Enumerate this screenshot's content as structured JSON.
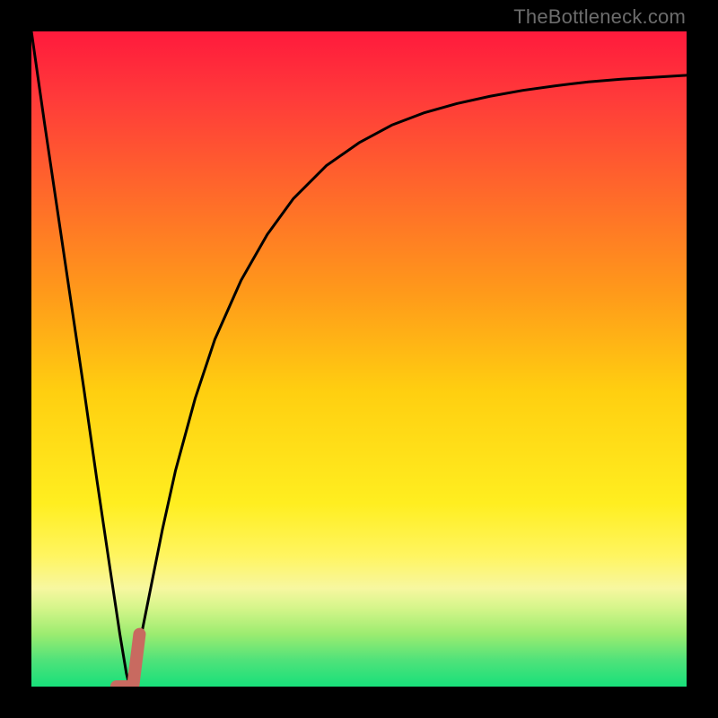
{
  "watermark": "TheBottleneck.com",
  "chart_data": {
    "type": "line",
    "title": "",
    "xlabel": "",
    "ylabel": "",
    "xlim": [
      0,
      100
    ],
    "ylim": [
      0,
      100
    ],
    "background": {
      "gradient_stops": [
        {
          "pos": 0.0,
          "color": "#ff1a3c"
        },
        {
          "pos": 0.1,
          "color": "#ff3a3a"
        },
        {
          "pos": 0.25,
          "color": "#ff6a2a"
        },
        {
          "pos": 0.4,
          "color": "#ff9a1a"
        },
        {
          "pos": 0.55,
          "color": "#ffcf10"
        },
        {
          "pos": 0.72,
          "color": "#ffee20"
        },
        {
          "pos": 0.8,
          "color": "#fff560"
        },
        {
          "pos": 0.85,
          "color": "#f7f7a0"
        },
        {
          "pos": 0.88,
          "color": "#d5f58a"
        },
        {
          "pos": 0.92,
          "color": "#9cec70"
        },
        {
          "pos": 0.96,
          "color": "#4fe27a"
        },
        {
          "pos": 1.0,
          "color": "#18e07a"
        }
      ]
    },
    "series": [
      {
        "name": "bottleneck-curve",
        "color": "#000000",
        "x": [
          0.0,
          2.0,
          4.0,
          6.0,
          8.0,
          10.0,
          12.0,
          13.5,
          14.5,
          15.0,
          16.0,
          18.0,
          20.0,
          22.0,
          25.0,
          28.0,
          32.0,
          36.0,
          40.0,
          45.0,
          50.0,
          55.0,
          60.0,
          65.0,
          70.0,
          75.0,
          80.0,
          85.0,
          90.0,
          95.0,
          100.0
        ],
        "y": [
          100.0,
          86.0,
          72.5,
          59.0,
          45.5,
          31.5,
          18.0,
          8.0,
          2.0,
          0.0,
          4.0,
          14.0,
          24.0,
          33.0,
          44.0,
          53.0,
          62.0,
          69.0,
          74.5,
          79.5,
          83.0,
          85.7,
          87.6,
          89.0,
          90.1,
          91.0,
          91.7,
          92.3,
          92.7,
          93.0,
          93.3
        ]
      }
    ],
    "marker": {
      "name": "highlight-segment",
      "color": "#c86a60",
      "points": [
        {
          "x": 13.0,
          "y": 0.0
        },
        {
          "x": 15.5,
          "y": 0.0
        },
        {
          "x": 16.5,
          "y": 8.0
        }
      ],
      "width": 14
    }
  }
}
